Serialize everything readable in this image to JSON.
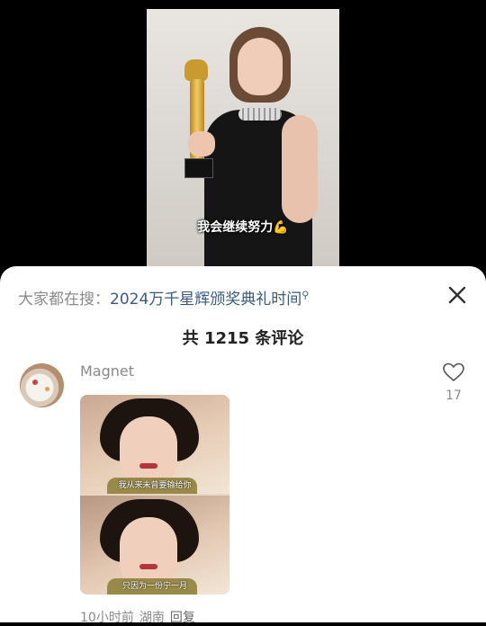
{
  "video": {
    "caption": "我会继续努力💪"
  },
  "sheet": {
    "search_prefix": "大家都在搜：",
    "search_term": "2024万千星辉颁奖典礼时间",
    "search_icon": "search-icon",
    "close_icon": "close-icon",
    "title": "共 1215 条评论"
  },
  "comment": {
    "username": "Magnet",
    "likes": "17",
    "like_icon": "heart-outline-icon",
    "time": "10小时前",
    "location": "湖南",
    "reply_label": "回复",
    "image_subtitles": [
      "我从来未曾要输给你",
      "只因为一份宁一月"
    ]
  }
}
